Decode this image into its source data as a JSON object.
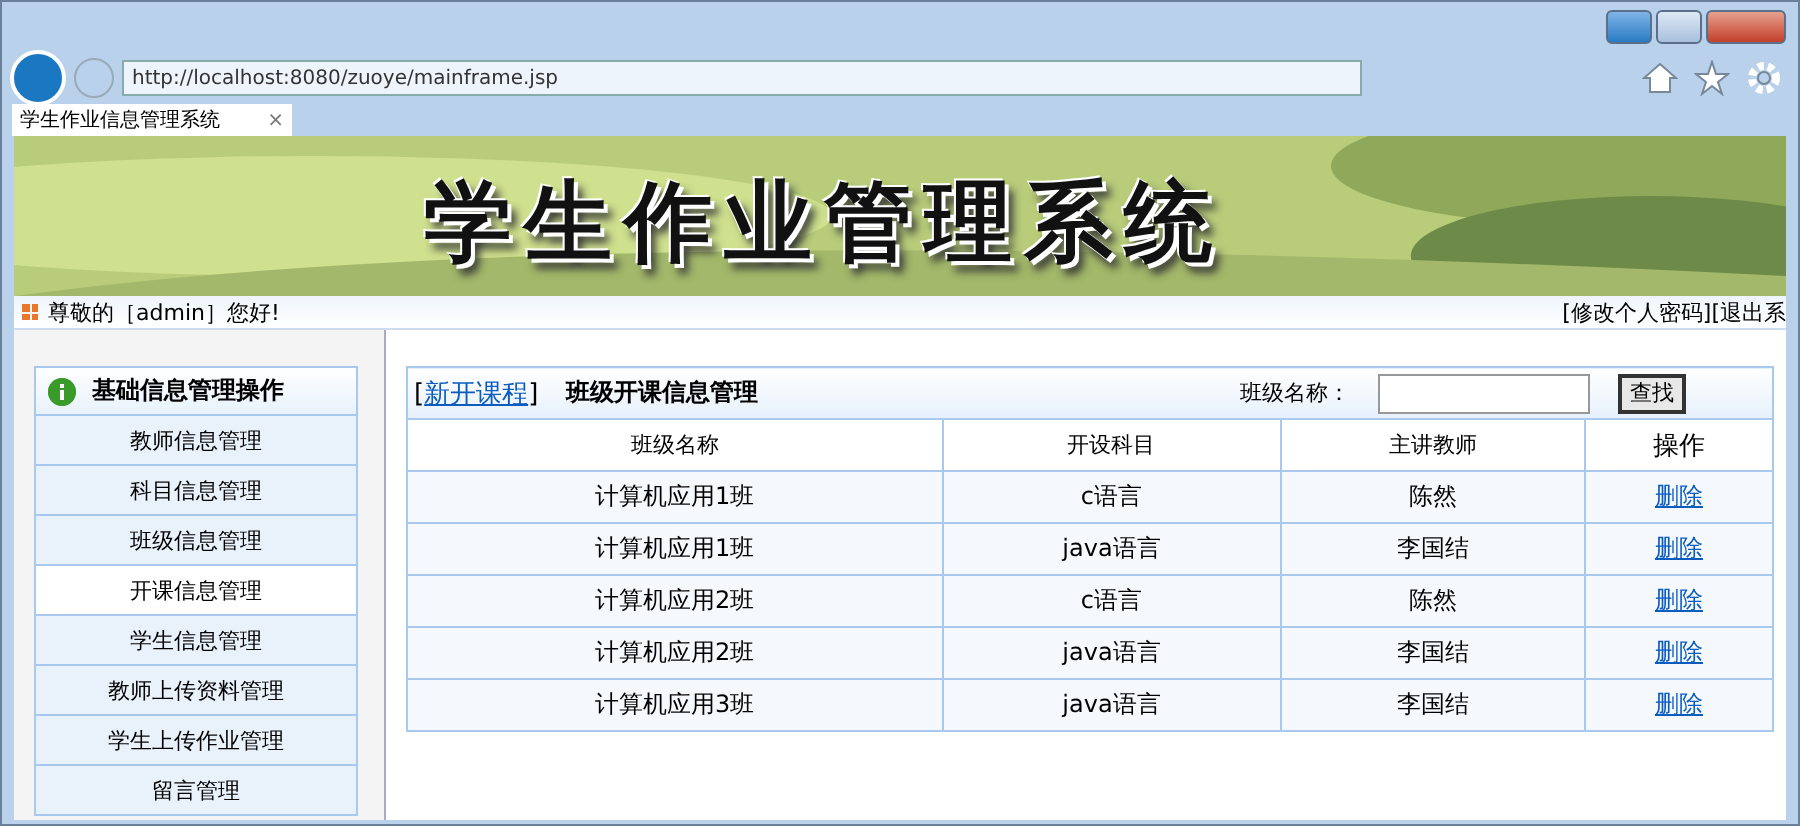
{
  "browser": {
    "url": "http://localhost:8080/zuoye/mainframe.jsp",
    "tab": {
      "title": "学生作业信息管理系统",
      "close": "×"
    }
  },
  "banner": {
    "title": "学生作业管理系统"
  },
  "topbar": {
    "greeting": "尊敬的［admin］您好!",
    "links": [
      "[修改个人密码]",
      "[退出系"
    ]
  },
  "sidebar": {
    "title": "基础信息管理操作",
    "items": [
      {
        "label": "教师信息管理",
        "selected": false
      },
      {
        "label": "科目信息管理",
        "selected": false
      },
      {
        "label": "班级信息管理",
        "selected": false
      },
      {
        "label": "开课信息管理",
        "selected": true
      },
      {
        "label": "学生信息管理",
        "selected": false
      },
      {
        "label": "教师上传资料管理",
        "selected": false
      },
      {
        "label": "学生上传作业管理",
        "selected": false
      },
      {
        "label": "留言管理",
        "selected": false
      }
    ]
  },
  "panel": {
    "bracket_open": "[",
    "new_link": "新开课程",
    "bracket_close": "]",
    "title": "班级开课信息管理",
    "search_label": "班级名称：",
    "search_button": "查找",
    "columns": [
      "班级名称",
      "开设科目",
      "主讲教师",
      "操作"
    ],
    "rows": [
      {
        "class": "计算机应用1班",
        "subject": "c语言",
        "teacher": "陈然",
        "action": "删除"
      },
      {
        "class": "计算机应用1班",
        "subject": "java语言",
        "teacher": "李国结",
        "action": "删除"
      },
      {
        "class": "计算机应用2班",
        "subject": "c语言",
        "teacher": "陈然",
        "action": "删除"
      },
      {
        "class": "计算机应用2班",
        "subject": "java语言",
        "teacher": "李国结",
        "action": "删除"
      },
      {
        "class": "计算机应用3班",
        "subject": "java语言",
        "teacher": "李国结",
        "action": "删除"
      }
    ]
  }
}
